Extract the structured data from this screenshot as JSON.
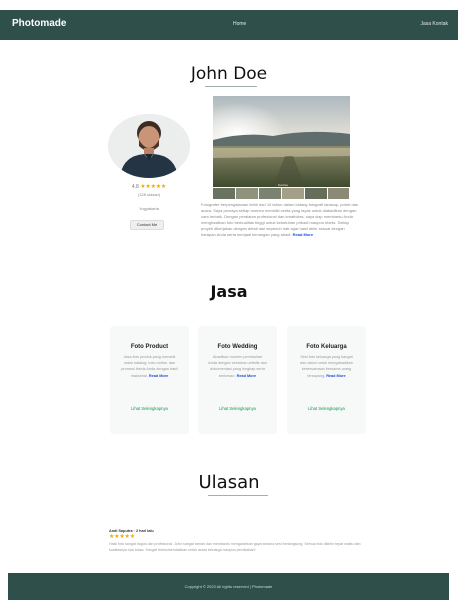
{
  "nav": {
    "brand": "Photomade",
    "center_link": "Home",
    "right_link": "Jasa   Kontak"
  },
  "profile": {
    "name": "John Doe",
    "rating_value": "4.8",
    "stars": "★★★★★",
    "rating_sub": "(128 ulasan)",
    "location": "Yogyakarta",
    "contact_label": "Contact Me",
    "photo_caption": "Sunrise",
    "bio": "Fotografer berpengalaman lebih dari 10 tahun dalam bidang fotografi lanskap, potret dan acara. Saya percaya setiap momen memiliki cerita yang layak untuk diabadikan dengan cara terbaik. Dengan peralatan profesional dan kreativitas, saya siap membantu Anda menghasilkan foto berkualitas tinggi untuk kebutuhan pribadi maupun bisnis. Setiap proyek dikerjakan dengan detail dan sepenuh hati agar hasil akhir sesuai dengan harapan Anda serta menjadi kenangan yang abadi.",
    "bio_more": "Read More"
  },
  "services": {
    "title": "Jasa",
    "cards": [
      {
        "title": "Foto Product",
        "desc": "Jasa foto produk yang menarik untuk katalog, toko online, dan promosi bisnis Anda dengan hasil maksimal.",
        "more": "Read More",
        "link": "Lihat Selengkapnya"
      },
      {
        "title": "Foto Wedding",
        "desc": "Abadikan momen pernikahan Anda dengan sentuhan artistik dan dokumentasi yang lengkap serta berkesan.",
        "more": "Read More",
        "link": "Lihat Selengkapnya"
      },
      {
        "title": "Foto Keluarga",
        "desc": "Sesi foto keluarga yang hangat dan alami untuk mengabadikan kebersamaan bersama orang tersayang.",
        "more": "Read More",
        "link": "Lihat Selengkapnya"
      }
    ]
  },
  "reviews": {
    "title": "Ulasan",
    "items": [
      {
        "author": "Andi Saputra · 2 hari lalu",
        "stars": "★★★★★",
        "text": "Hasil foto sangat bagus dan profesional. John sangat ramah dan membantu mengarahkan gaya selama sesi berlangsung. Semua foto dikirim tepat waktu dan kualitasnya luar biasa. Sangat direkomendasikan untuk acara keluarga maupun pernikahan!"
      }
    ]
  },
  "footer": {
    "text": "Copyright © 2023 All rights reserved | Photomade"
  },
  "colors": {
    "nav_bg": "#2f4f4a",
    "link_blue": "#1d4ed8",
    "star": "#f2a900",
    "green_link": "#159a55"
  }
}
